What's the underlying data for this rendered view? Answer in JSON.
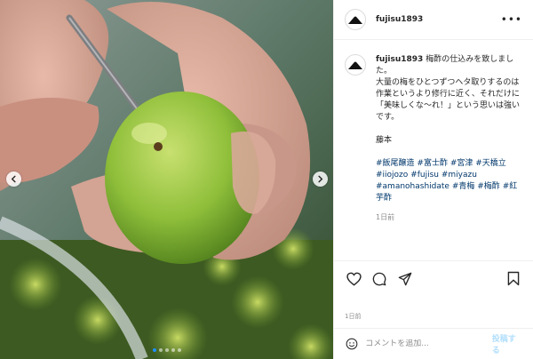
{
  "post": {
    "username": "fujisu1893",
    "more_icon": "more-options-icon",
    "caption": {
      "username": "fujisu1893",
      "lines": [
        "梅酢の仕込みを致しました。",
        "大量の梅をひとつずつヘタ取りするのは作業というより修行に近く、それだけに「美味しくな〜れ！」という思いは強いです。"
      ],
      "signature": "藤本",
      "hashtags": [
        "#飯尾醸造",
        "#富士酢",
        "#宮津",
        "#天橋立",
        "#iiojozo",
        "#fujisu",
        "#miyazu",
        "#amanohashidate",
        "#青梅",
        "#梅酢",
        "#紅芋酢"
      ],
      "time": "1日前"
    },
    "timestamp": "1日前",
    "carousel": {
      "total": 5,
      "active": 0
    }
  },
  "comment": {
    "placeholder": "コメントを追加...",
    "post_label": "投稿する"
  },
  "colors": {
    "link": "#00376b",
    "muted": "#8e8e8e",
    "post_button": "#b2dffc",
    "active_dot": "#1e90ff"
  }
}
